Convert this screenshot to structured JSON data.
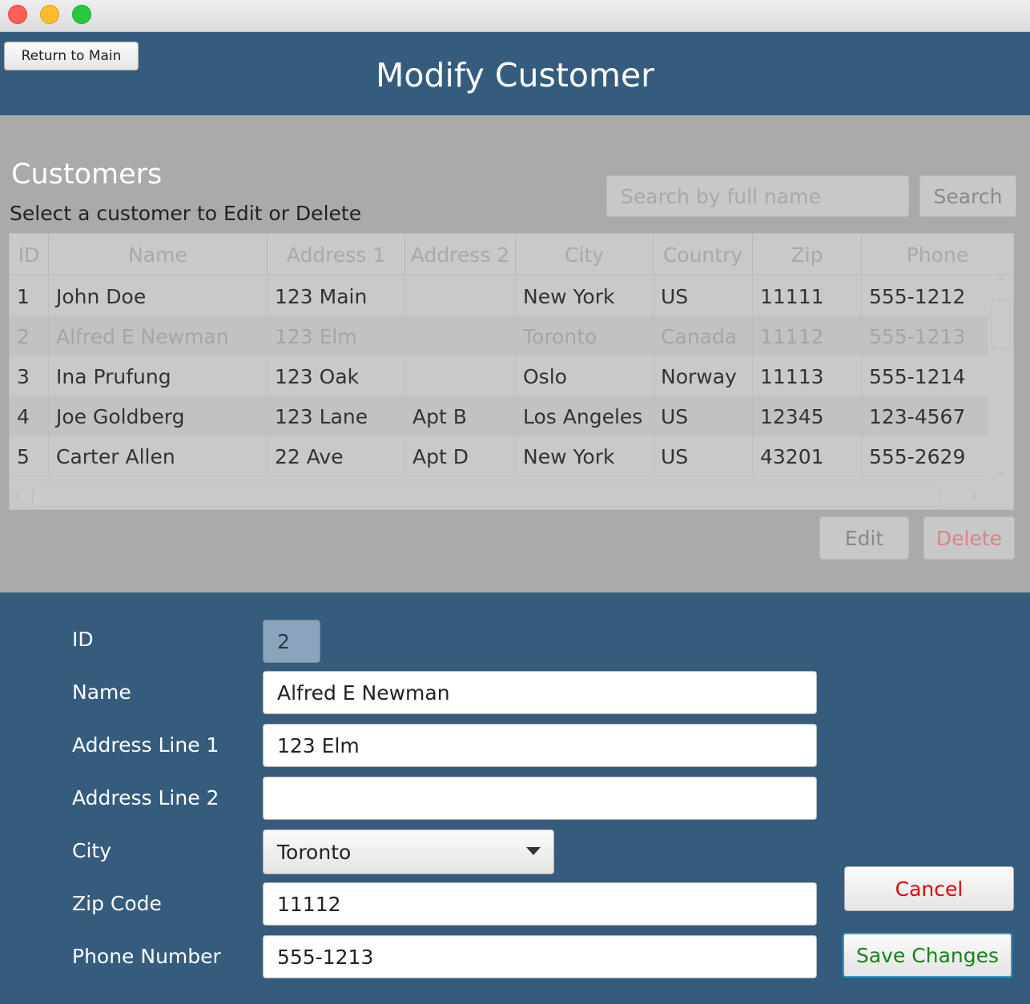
{
  "window": {
    "traffic_lights": [
      "close",
      "minimize",
      "zoom"
    ]
  },
  "header": {
    "return_label": "Return to Main",
    "title": "Modify Customer"
  },
  "customers": {
    "title": "Customers",
    "subtitle": "Select a customer to Edit or Delete",
    "search_placeholder": "Search by full name",
    "search_label": "Search",
    "edit_label": "Edit",
    "delete_label": "Delete"
  },
  "table": {
    "columns": [
      "ID",
      "Name",
      "Address 1",
      "Address 2",
      "City",
      "Country",
      "Zip",
      "Phone"
    ],
    "selected_row": 1,
    "rows": [
      [
        "1",
        "John Doe",
        "123 Main",
        "",
        "New York",
        "US",
        "11111",
        "555-1212"
      ],
      [
        "2",
        "Alfred E Newman",
        "123 Elm",
        "",
        "Toronto",
        "Canada",
        "11112",
        "555-1213"
      ],
      [
        "3",
        "Ina Prufung",
        "123 Oak",
        "",
        "Oslo",
        "Norway",
        "11113",
        "555-1214"
      ],
      [
        "4",
        "Joe Goldberg",
        "123 Lane",
        "Apt B",
        "Los Angeles",
        "US",
        "12345",
        "123-4567"
      ],
      [
        "5",
        "Carter Allen",
        "22 Ave",
        "Apt D",
        "New York",
        "US",
        "43201",
        "555-2629"
      ]
    ]
  },
  "form": {
    "id_label": "ID",
    "id_value": "2",
    "name_label": "Name",
    "name_value": "Alfred E Newman",
    "address1_label": "Address Line 1",
    "address1_value": "123 Elm",
    "address2_label": "Address Line 2",
    "address2_value": "",
    "city_label": "City",
    "city_value": "Toronto",
    "zip_label": "Zip Code",
    "zip_value": "11112",
    "phone_label": "Phone Number",
    "phone_value": "555-1213",
    "cancel_label": "Cancel",
    "save_label": "Save Changes"
  },
  "colors": {
    "header_blue": "#355c7d",
    "panel_grey": "#aaaaaa",
    "cancel_red": "#e00000",
    "save_green": "#18821a",
    "delete_red": "#d98585"
  }
}
